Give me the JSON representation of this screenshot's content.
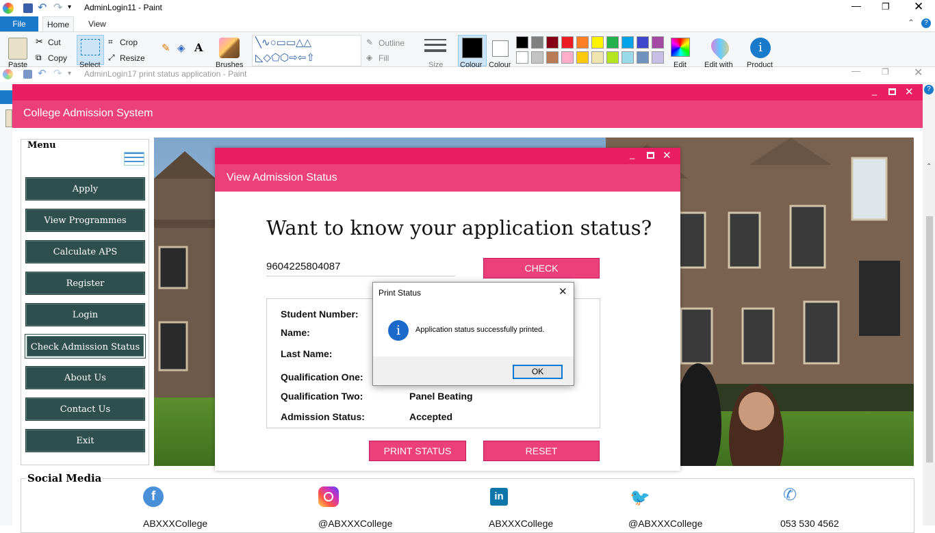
{
  "paint_back": {
    "title": "AdminLogin11 - Paint",
    "menu": {
      "file": "File",
      "home": "Home",
      "view": "View"
    },
    "ribbon": {
      "paste": "Paste",
      "cut": "Cut",
      "copy": "Copy",
      "select": "Select",
      "crop": "Crop",
      "resize": "Resize",
      "brushes": "Brushes",
      "outline": "Outline",
      "fill": "Fill",
      "size": "Size",
      "colour1": "Colour",
      "colour2": "Colour",
      "edit": "Edit",
      "edit_with": "Edit with",
      "product": "Product"
    },
    "palette": [
      "#000000",
      "#7f7f7f",
      "#880015",
      "#ed1c24",
      "#ff7f27",
      "#fff200",
      "#22b14c",
      "#00a2e8",
      "#3f48cc",
      "#a349a4",
      "#ffffff",
      "#c3c3c3",
      "#b97a57",
      "#ffaec9",
      "#ffc90e",
      "#efe4b0",
      "#b5e61d",
      "#99d9ea",
      "#7092be",
      "#c8bfe7"
    ]
  },
  "paint_front": {
    "title": "AdminLogin17 print status application - Paint"
  },
  "app": {
    "title": "College Admission System",
    "menu_title": "Menu",
    "menu": [
      "Apply",
      "View Programmes",
      "Calculate APS",
      "Register",
      "Login",
      "Check Admission Status",
      "About Us",
      "Contact Us",
      "Exit"
    ],
    "social": {
      "title": "Social Media",
      "items": [
        {
          "icon": "facebook-icon",
          "label": "ABXXXCollege"
        },
        {
          "icon": "instagram-icon",
          "label": "@ABXXXCollege"
        },
        {
          "icon": "linkedin-icon",
          "label": "ABXXXCollege"
        },
        {
          "icon": "twitter-icon",
          "label": "@ABXXXCollege"
        },
        {
          "icon": "phone-icon",
          "label": "053 530 4562"
        }
      ]
    }
  },
  "dialog": {
    "title": "View Admission Status",
    "heading": "Want to know your application status?",
    "id_value": "9604225804087",
    "check_label": "CHECK",
    "labels": {
      "student_number": "Student Number:",
      "name": "Name:",
      "last_name": "Last Name:",
      "qual_one": "Qualification One:",
      "qual_two": "Qualification Two:",
      "status": "Admission Status:"
    },
    "values": {
      "qual_two": "Panel Beating",
      "status": "Accepted"
    },
    "print_label": "PRINT STATUS",
    "reset_label": "RESET"
  },
  "msgbox": {
    "title": "Print Status",
    "message": "Application status successfully printed.",
    "ok": "OK"
  },
  "colors": {
    "accent": "#ec407a",
    "accent_dark": "#e91e63",
    "menu_button": "#2f4f4f",
    "paint_blue": "#1979ca"
  }
}
